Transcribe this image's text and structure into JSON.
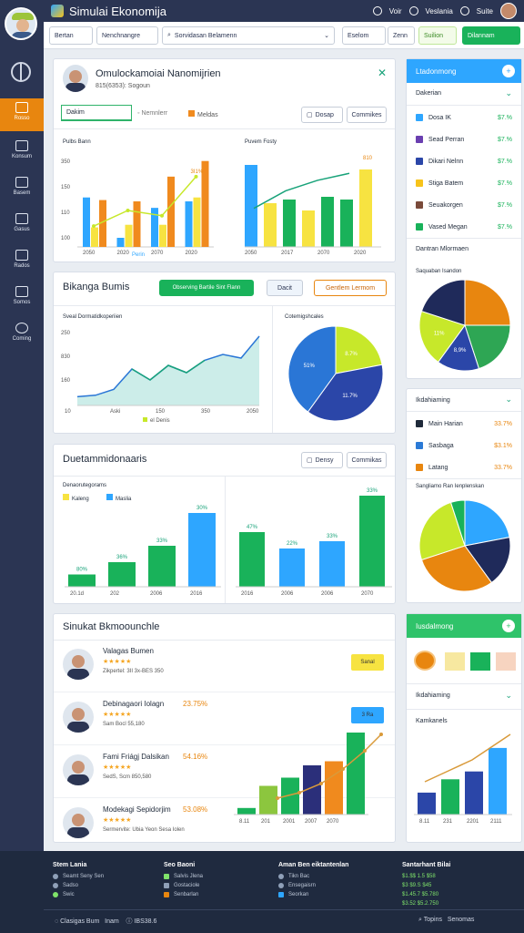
{
  "app": {
    "title": "Simulai Ekonomija",
    "top_links": [
      "Voir",
      "Veslania",
      "Suite"
    ]
  },
  "sidebar": {
    "items": [
      "Rosso",
      "Konsum",
      "Basem",
      "Gasus",
      "Rados",
      "Somos",
      "Coming"
    ]
  },
  "toolbar": {
    "b1": "Bertan",
    "b2": "Nenchnangre",
    "search": "Sorvidasan Belamenn",
    "b4": "Eselom",
    "b5": "Zenn",
    "b6": "Suilion",
    "b7": "Dilannam"
  },
  "card1": {
    "title": "Omulockamoiai Nanomijrien",
    "subtitle": "815(6353): Sogoun",
    "tab_input": "Dakim",
    "legend": [
      "Nemnlerr",
      "Meldas"
    ],
    "btn1": "Dosap",
    "btn2": "Commikes",
    "chart_a_title": "Pulbs Bann",
    "chart_b_title": "Puvem Fosty",
    "chart_a_data": {
      "type": "bar",
      "categories": [
        "2050",
        "2020",
        "2070",
        "2020"
      ],
      "series": [
        {
          "color": "#2ea6ff",
          "values": [
            190,
            35,
            150,
            175
          ]
        },
        {
          "color": "#f7e341",
          "values": [
            75,
            85,
            85,
            190
          ]
        },
        {
          "color": "#f08a1e",
          "values": [
            180,
            175,
            270,
            330
          ]
        }
      ],
      "line": [
        80,
        140,
        120,
        270
      ],
      "ylabels": [
        "350",
        "150",
        "110",
        "100"
      ],
      "legend": "Perin",
      "label_top": "3I1%"
    },
    "chart_b_data": {
      "type": "bar",
      "categories": [
        "2050",
        "2017",
        "2070",
        "2020"
      ],
      "line": [
        110,
        160,
        190,
        210
      ],
      "label_top": "810"
    }
  },
  "card2": {
    "title": "Bikanga Bumis",
    "btn_green": "Observing Bartile Sint Flann",
    "btn_blue": "Dacit",
    "btn_orange": "Gentlem Lermom",
    "area_title": "Sveal Dormatidkoperiien",
    "area_ylabels": [
      "250",
      "830",
      "160"
    ],
    "area_xlabels": [
      "10",
      "Aski",
      "150",
      "350",
      "2050"
    ],
    "area_legend": "el Denis",
    "area_values": [
      12,
      14,
      22,
      50,
      35,
      55,
      45,
      62,
      70,
      65,
      95
    ],
    "pie_title": "Cotemigshcales",
    "pie_data": [
      {
        "label": "8.7%",
        "value": 22,
        "color": "#c7e82a"
      },
      {
        "label": "11.7%",
        "value": 38,
        "color": "#2b46a8"
      },
      {
        "label": "51%",
        "value": 40,
        "color": "#2a76d6"
      }
    ]
  },
  "card3": {
    "title": "Duetammidonaaris",
    "btn1": "Densy",
    "btn2": "Commikas",
    "left_title": "Denaorutegorams",
    "left_legend": [
      "Kaleng",
      "Maslia"
    ],
    "left_bars": [
      {
        "v": 15,
        "c": "#19b25a",
        "l": "80%"
      },
      {
        "v": 30,
        "c": "#19b25a",
        "l": "36%"
      },
      {
        "v": 50,
        "c": "#19b25a",
        "l": "33%"
      },
      {
        "v": 90,
        "c": "#2ea6ff",
        "l": "30%"
      }
    ],
    "left_xlabels": [
      "20.1d",
      "202",
      "2006",
      "2016"
    ],
    "right_bars": [
      {
        "v": 60,
        "c": "#19b25a",
        "l": "47%"
      },
      {
        "v": 42,
        "c": "#2ea6ff",
        "l": "22%"
      },
      {
        "v": 50,
        "c": "#2ea6ff",
        "l": "33%"
      },
      {
        "v": 100,
        "c": "#19b25a",
        "l": "33%"
      }
    ],
    "right_xlabels": [
      "2016",
      "2006",
      "2006",
      "2070"
    ]
  },
  "card4": {
    "title": "Sinukat Bkmoounchle",
    "rows": [
      {
        "name": "Valagas Bumen",
        "pct": "",
        "detail": "Zikpertel: 3II 3x-BES 350",
        "btn": "Sanal",
        "btn_color": "#f7e341"
      },
      {
        "name": "Debinagaori Iolagn",
        "pct": "23.75%",
        "detail": "Sam Bocl 55,180",
        "btn": "3 Ra",
        "btn_color": "#2ea6ff"
      },
      {
        "name": "Fami Friágj Dalsikan",
        "pct": "54.16%",
        "detail": "SedS, Scm 850,580",
        "btn": "",
        "btn_color": ""
      },
      {
        "name": "Modekagi Sepidorjim",
        "pct": "53.08%",
        "detail": "Sermervite: Ubia Yeon Sesa Iolen",
        "btn": "",
        "btn_color": ""
      }
    ],
    "bars": [
      {
        "v": 8,
        "c": "#19b25a"
      },
      {
        "v": 35,
        "c": "#8cc63e"
      },
      {
        "v": 45,
        "c": "#19b25a"
      },
      {
        "v": 60,
        "c": "#2b2f7a"
      },
      {
        "v": 65,
        "c": "#f08a1e"
      },
      {
        "v": 100,
        "c": "#19b25a"
      }
    ],
    "xlabels": [
      "8.11",
      "201",
      "2001",
      "2007",
      "2070"
    ]
  },
  "right1": {
    "header": "Ltadonmong",
    "section": "Dakerian",
    "items": [
      {
        "label": "Dosa IK",
        "value": "$7.%",
        "color": "#2ea6ff"
      },
      {
        "label": "Sead Perran",
        "value": "$7.%",
        "color": "#6a3fb0"
      },
      {
        "label": "Dikari Nelnn",
        "value": "$7.%",
        "color": "#2b46a8"
      },
      {
        "label": "Stiga Batem",
        "value": "$7.%",
        "color": "#f7c31a"
      },
      {
        "label": "Seuakorgen",
        "value": "$7.%",
        "color": "#7a4a3a"
      },
      {
        "label": "Vased Megan",
        "value": "$7.%",
        "color": "#19b25a"
      }
    ],
    "sub": "Dantran Mlormaen",
    "pie_title": "Saquaban Isandon",
    "pie_data": [
      {
        "label": "",
        "value": 25,
        "color": "#e8860f"
      },
      {
        "label": "",
        "value": 20,
        "color": "#2ea654"
      },
      {
        "label": "8,9%",
        "value": 15,
        "color": "#2b46a8"
      },
      {
        "label": "11%",
        "value": 20,
        "color": "#c7e82a"
      },
      {
        "label": "",
        "value": 20,
        "color": "#1f2a5a"
      }
    ]
  },
  "right2": {
    "header": "Ikdahiaming",
    "items": [
      {
        "label": "Main Harian",
        "value": "33.7%",
        "color": "#1f2a3a"
      },
      {
        "label": "Sasbaga",
        "value": "$3.1%",
        "color": "#2b7ad6"
      },
      {
        "label": "Latang",
        "value": "33.7%",
        "color": "#e8860f"
      }
    ],
    "pie_title": "Sangliamo Ran Ienplenskan",
    "pie_data": [
      {
        "label": "",
        "value": 22,
        "color": "#2ea6ff"
      },
      {
        "label": "",
        "value": 18,
        "color": "#1f2a5a"
      },
      {
        "label": "",
        "value": 30,
        "color": "#e8860f"
      },
      {
        "label": "",
        "value": 25,
        "color": "#c7e82a"
      },
      {
        "label": "",
        "value": 5,
        "color": "#19b25a"
      }
    ]
  },
  "right3": {
    "header": "Iusdalmong",
    "section": "Ikdahiaming",
    "chart_title": "Kamkanels",
    "bars": [
      {
        "v": 28,
        "c": "#2b46a8"
      },
      {
        "v": 45,
        "c": "#19b25a"
      },
      {
        "v": 55,
        "c": "#2b46a8"
      },
      {
        "v": 85,
        "c": "#2ea6ff"
      }
    ],
    "xlabels": [
      "8.11",
      "231",
      "2201",
      "2111"
    ]
  },
  "footer": {
    "col1": {
      "title": "Stem Lania",
      "items": [
        "Seamt Seny Sen",
        "Sadso",
        "Swic"
      ]
    },
    "col2": {
      "title": "Seo Baoni",
      "items": [
        "Salvis Jlena",
        "Gostaciole",
        "Senbarlan"
      ]
    },
    "col3": {
      "title": "Aman Ben eiktantenlan",
      "items": [
        "Tikn Bac",
        "Ensegaisrn",
        "Seorkan"
      ]
    },
    "col4": {
      "title": "Santarhant Bilai",
      "items": [
        "$1.$$ 1.5 $58",
        "$3 $9.S $45",
        "$1.45.7 $5.780",
        "$3.52 $5.2.750"
      ]
    },
    "bottom": [
      "Clasigas Bum",
      "Inam",
      "IBS38.6",
      "Topins",
      "Senomas"
    ]
  }
}
